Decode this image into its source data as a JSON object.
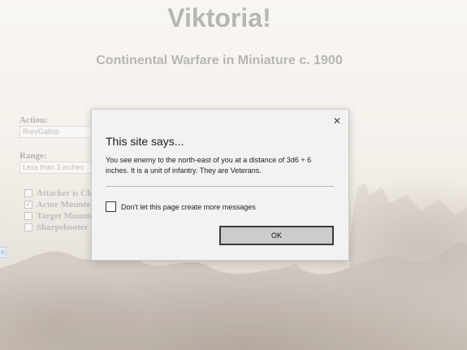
{
  "page": {
    "title": "Viktoria!",
    "subtitle": "Continental Warfare in Miniature c. 1900"
  },
  "form": {
    "action_label": "Action:",
    "action_value": "Run/Gallop",
    "range_label": "Range:",
    "range_value": "Less than 3 inches",
    "checkboxes": [
      {
        "label": "Attacker is Ch",
        "checked": false
      },
      {
        "label": "Actor Mounted",
        "checked": true
      },
      {
        "label": "Target Mounte",
        "checked": false
      },
      {
        "label": "Sharpshooter",
        "checked": false
      }
    ]
  },
  "side_tab": {
    "label": "e"
  },
  "dialog": {
    "close_glyph": "✕",
    "title": "This site says...",
    "message": "You see enemy to the north-east of you at a distance of 3d6 + 6 inches. It is a unit of infantry. They are Veterans.",
    "suppress_label": "Don't let this page create more messages",
    "suppress_checked": false,
    "ok_label": "OK"
  }
}
